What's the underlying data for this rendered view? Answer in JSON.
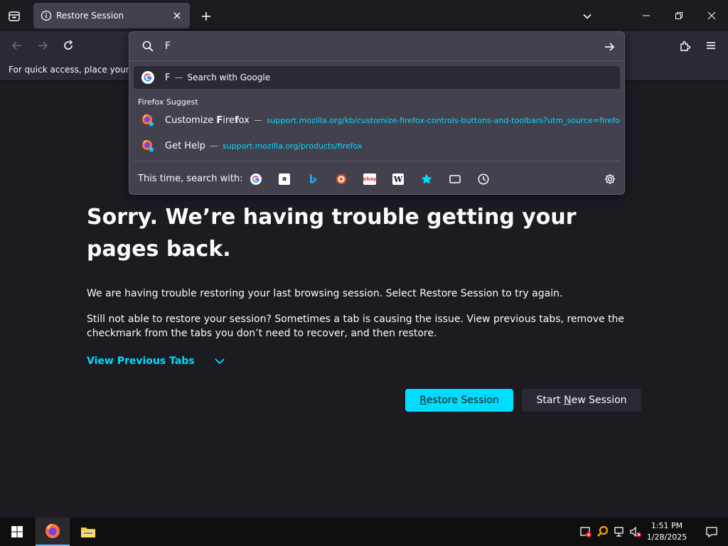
{
  "tab": {
    "title": "Restore Session"
  },
  "bookmarks_bar": {
    "text": "For quick access, place your boo"
  },
  "urlbar": {
    "value": "F",
    "results": [
      {
        "title": "F",
        "action": "Search with Google"
      }
    ],
    "suggest_header": "Firefox Suggest",
    "suggestions": [
      {
        "title_prefix": "Customize ",
        "title_match": "F",
        "title_mid": "ire",
        "title_match2": "f",
        "title_rest": "ox",
        "url": "support.mozilla.org/kb/customize-firefox-controls-buttons-and-toolbars?utm_source=firefox"
      },
      {
        "title_prefix": "Get Help",
        "url": "support.mozilla.org/products/firefox"
      }
    ],
    "separator": "—",
    "oneoff_label": "This time, search with:",
    "oneoff_engines": [
      "google",
      "amazon",
      "bing",
      "duckduckgo",
      "ebay",
      "wikipedia",
      "bookmarks",
      "tabs",
      "history"
    ]
  },
  "page": {
    "title": "Sorry. We’re having trouble getting your pages back.",
    "para1": "We are having trouble restoring your last browsing session. Select Restore Session to try again.",
    "para2": "Still not able to restore your session? Sometimes a tab is causing the issue. View previous tabs, remove the checkmark from the tabs you don’t need to recover, and then restore.",
    "view_previous": "View Previous Tabs",
    "restore_prefix": "",
    "restore_accel": "R",
    "restore_rest": "estore Session",
    "new_prefix": "Start ",
    "new_accel": "N",
    "new_rest": "ew Session"
  },
  "taskbar": {
    "time": "1:51 PM",
    "date": "1/28/2025"
  },
  "colors": {
    "accent": "#00ddff",
    "background": "#1c1b22",
    "toolbar": "#2b2a33",
    "popup": "#42414d"
  }
}
